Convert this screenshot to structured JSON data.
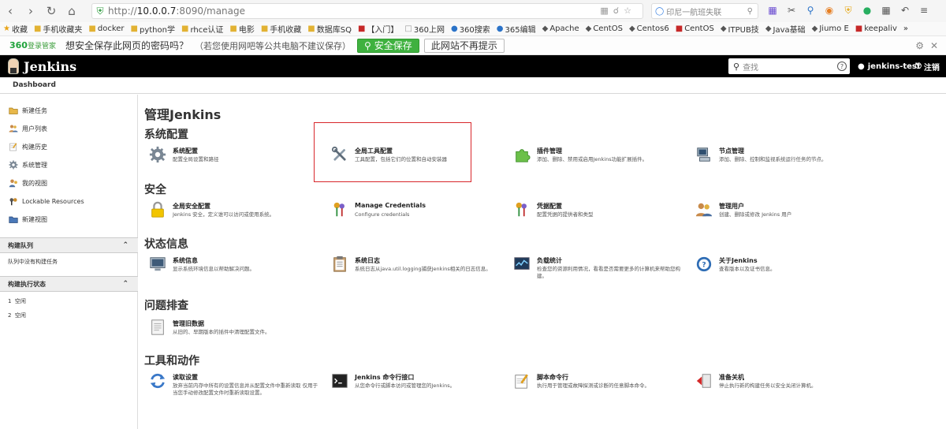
{
  "browser": {
    "url_scheme": "http://",
    "url_host": "10.0.0.7",
    "url_rest": ":8090/manage",
    "search_placeholder": "印尼一航班失联",
    "bookmarks": [
      {
        "icon": "star-icon",
        "label": "收藏"
      },
      {
        "icon": "folder-icon",
        "label": "手机收藏夹"
      },
      {
        "icon": "folder-icon",
        "label": "docker"
      },
      {
        "icon": "folder-icon",
        "label": "python学"
      },
      {
        "icon": "folder-icon",
        "label": "rhce认证"
      },
      {
        "icon": "folder-icon",
        "label": "电影"
      },
      {
        "icon": "folder-icon",
        "label": "手机收藏"
      },
      {
        "icon": "folder-icon",
        "label": "数据库SQ"
      },
      {
        "icon": "red-icon",
        "label": "【入门】"
      },
      {
        "icon": "doc-icon",
        "label": "360上网"
      },
      {
        "icon": "blue-icon",
        "label": "360搜索"
      },
      {
        "icon": "blue-icon",
        "label": "365编辑"
      },
      {
        "icon": "dark-icon",
        "label": "Apache"
      },
      {
        "icon": "dark-icon",
        "label": "CentOS"
      },
      {
        "icon": "dark-icon",
        "label": "Centos6"
      },
      {
        "icon": "red-icon",
        "label": "CentOS"
      },
      {
        "icon": "dark-icon",
        "label": "ITPUB技"
      },
      {
        "icon": "dark-icon",
        "label": "Java基础"
      },
      {
        "icon": "dark-icon",
        "label": "Jiumo E"
      },
      {
        "icon": "red-icon",
        "label": "keepaliv"
      }
    ],
    "more": "»"
  },
  "password_bar": {
    "brand": "360",
    "brand_sub": "登录管家",
    "message": "想安全保存此网页的密码吗？",
    "hint": "（若您使用网吧等公共电脑不建议保存）",
    "save_label": "安全保存",
    "never_label": "此网站不再提示"
  },
  "jenkins": {
    "title": "Jenkins",
    "search_placeholder": "查找",
    "user": "jenkins-test",
    "logout": "注销",
    "breadcrumb": "Dashboard"
  },
  "sidebar": {
    "items": [
      {
        "label": "新建任务",
        "icon": "folder-new-icon"
      },
      {
        "label": "用户列表",
        "icon": "users-icon"
      },
      {
        "label": "构建历史",
        "icon": "notepad-icon"
      },
      {
        "label": "系统管理",
        "icon": "gear-icon"
      },
      {
        "label": "我的视图",
        "icon": "user-view-icon"
      },
      {
        "label": "Lockable Resources",
        "icon": "lock-resource-icon"
      },
      {
        "label": "新建视图",
        "icon": "folder-icon"
      }
    ],
    "build_queue": {
      "title": "构建队列",
      "empty": "队列中没有构建任务"
    },
    "executors": {
      "title": "构建执行状态",
      "rows": [
        {
          "num": "1",
          "state": "空闲"
        },
        {
          "num": "2",
          "state": "空闲"
        }
      ]
    }
  },
  "main": {
    "title": "管理Jenkins",
    "sections": [
      {
        "title": "系统配置",
        "items": [
          {
            "title": "系统配置",
            "desc": "配置全局设置和路径",
            "icon": "gear-icon"
          },
          {
            "title": "全局工具配置",
            "desc": "工具配置，包括它们的位置和自动安装器",
            "icon": "tools-icon"
          },
          {
            "title": "插件管理",
            "desc": "添加、删除、禁用或启用Jenkins功能扩展插件。",
            "icon": "puzzle-icon"
          },
          {
            "title": "节点管理",
            "desc": "添加、删除、控制和监视系统运行任务的节点。",
            "icon": "computer-icon"
          }
        ]
      },
      {
        "title": "安全",
        "items": [
          {
            "title": "全局安全配置",
            "desc": "Jenkins 安全，定义谁可以访问或使用系统。",
            "icon": "lock-icon"
          },
          {
            "title": "Manage Credentials",
            "desc": "Configure credentials",
            "icon": "keys-icon"
          },
          {
            "title": "凭据配置",
            "desc": "配置凭据的提供者和类型",
            "icon": "keys-icon"
          },
          {
            "title": "管理用户",
            "desc": "创建、删除或修改 Jenkins 用户",
            "icon": "users-icon"
          }
        ]
      },
      {
        "title": "状态信息",
        "items": [
          {
            "title": "系统信息",
            "desc": "显示系统环境信息以帮助解决问题。",
            "icon": "monitor-icon"
          },
          {
            "title": "系统日志",
            "desc": "系统日志从java.util.logging捕获Jenkins相关的日志信息。",
            "icon": "clipboard-icon"
          },
          {
            "title": "负载统计",
            "desc": "检查您的资源利用情况，看看是否需要更多的计算机来帮助您构建。",
            "icon": "chart-icon"
          },
          {
            "title": "关于Jenkins",
            "desc": "查看版本以及证书信息。",
            "icon": "help-icon"
          }
        ]
      },
      {
        "title": "问题排查",
        "items": [
          {
            "title": "管理旧数据",
            "desc": "从旧的、早期版本的插件中清理配置文件。",
            "icon": "document-icon"
          }
        ]
      },
      {
        "title": "工具和动作",
        "items": [
          {
            "title": "读取设置",
            "desc": "放弃当前内存中所有的设置信息并从配置文件中重新读取 仅用于当您手动修改配置文件时重新读取设置。",
            "icon": "reload-icon"
          },
          {
            "title": "Jenkins 命令行接口",
            "desc": "从您命令行或脚本访问或管理您的Jenkins。",
            "icon": "terminal-icon"
          },
          {
            "title": "脚本命令行",
            "desc": "执行用于管理或故障探测或诊断的任意脚本命令。",
            "icon": "notepad-icon"
          },
          {
            "title": "准备关机",
            "desc": "停止执行新的构建任务以安全关闭计算机。",
            "icon": "shutdown-icon"
          }
        ]
      }
    ]
  }
}
